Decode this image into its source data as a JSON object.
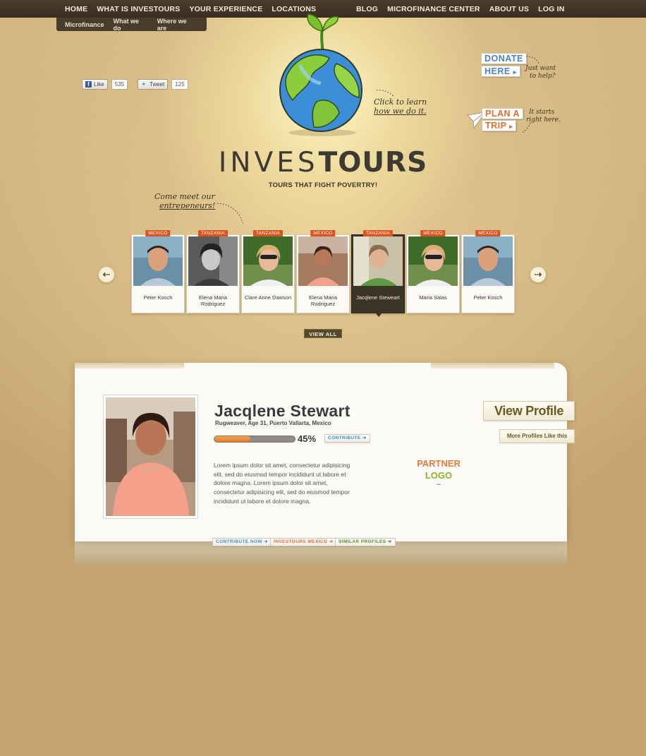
{
  "nav": {
    "left": [
      "HOME",
      "WHAT IS INVESTOURS",
      "YOUR EXPERIENCE",
      "LOCATIONS"
    ],
    "right": [
      "BLOG",
      "MICROFINANCE CENTER",
      "ABOUT US",
      "LOG IN"
    ],
    "sub": [
      "Microfinance",
      "What we do",
      "Where we are"
    ]
  },
  "social": {
    "like_label": "Like",
    "like_count": "535",
    "tweet_label": "Tweet",
    "tweet_count": "125"
  },
  "brand": {
    "title_light": "INVES",
    "title_bold": "TOURS",
    "tagline": "TOURS THAT FIGHT POVERTRY!"
  },
  "notes": {
    "learn_line1": "Click to learn",
    "learn_line2": "how we do it.",
    "meet_line1": "Come meet our",
    "meet_line2": "entrepeneurs!",
    "help_line1": "Just want",
    "help_line2": "to help?",
    "starts_line1": "It starts",
    "starts_line2": "right here."
  },
  "cta": {
    "donate": "DONATE",
    "here": "HERE",
    "plan": "PLAN A",
    "trip": "TRIP"
  },
  "entrepreneurs": [
    {
      "country": "MEXICO",
      "name": "Peter Kosch"
    },
    {
      "country": "TANZANIA",
      "name": "Elena Maria Rodriguez"
    },
    {
      "country": "TANZANIA",
      "name": "Clare Anne Dawson"
    },
    {
      "country": "MEXICO",
      "name": "Elena Maria Rodriguez"
    },
    {
      "country": "TANZANIA",
      "name": "Jacqlene Steweart"
    },
    {
      "country": "MEXICO",
      "name": "Maria Salas"
    },
    {
      "country": "MEXICO",
      "name": "Peter Kosch"
    }
  ],
  "active_index": 4,
  "view_all": "VIEW ALL",
  "profile": {
    "name": "Jacqlene Stewart",
    "subtitle": "Rugweaver, Age 31, Puerto Vallarta, Mexico",
    "progress": 0.45,
    "progress_label": "45%",
    "contribute": "CONTRIBUTE",
    "bio": "Lorem ipsum dolor sit amet, consectetur adipisicing elit, sed do eiusmod tempor incididunt ut labore et dolore magna. Lorem ipsum dolor sit amet, consectetur adipisicing elit, sed do eiusmod tempor incididunt ut labore et dolore magna.",
    "partner_l1": "PARTNER",
    "partner_l2": "LOGO",
    "partner_l3": "~",
    "view_profile": "View Profile",
    "more_profiles": "More Profiles Like this",
    "footer_buttons": [
      "CONTRIBUTE NOW",
      "INVESTOURS MEXICO",
      "SIMILAR PROFILES"
    ]
  },
  "colors": {
    "nav_bg": "#3a2e21",
    "accent_orange": "#d9541f",
    "accent_blue": "#4f80c7",
    "accent_green": "#8cb52b"
  }
}
